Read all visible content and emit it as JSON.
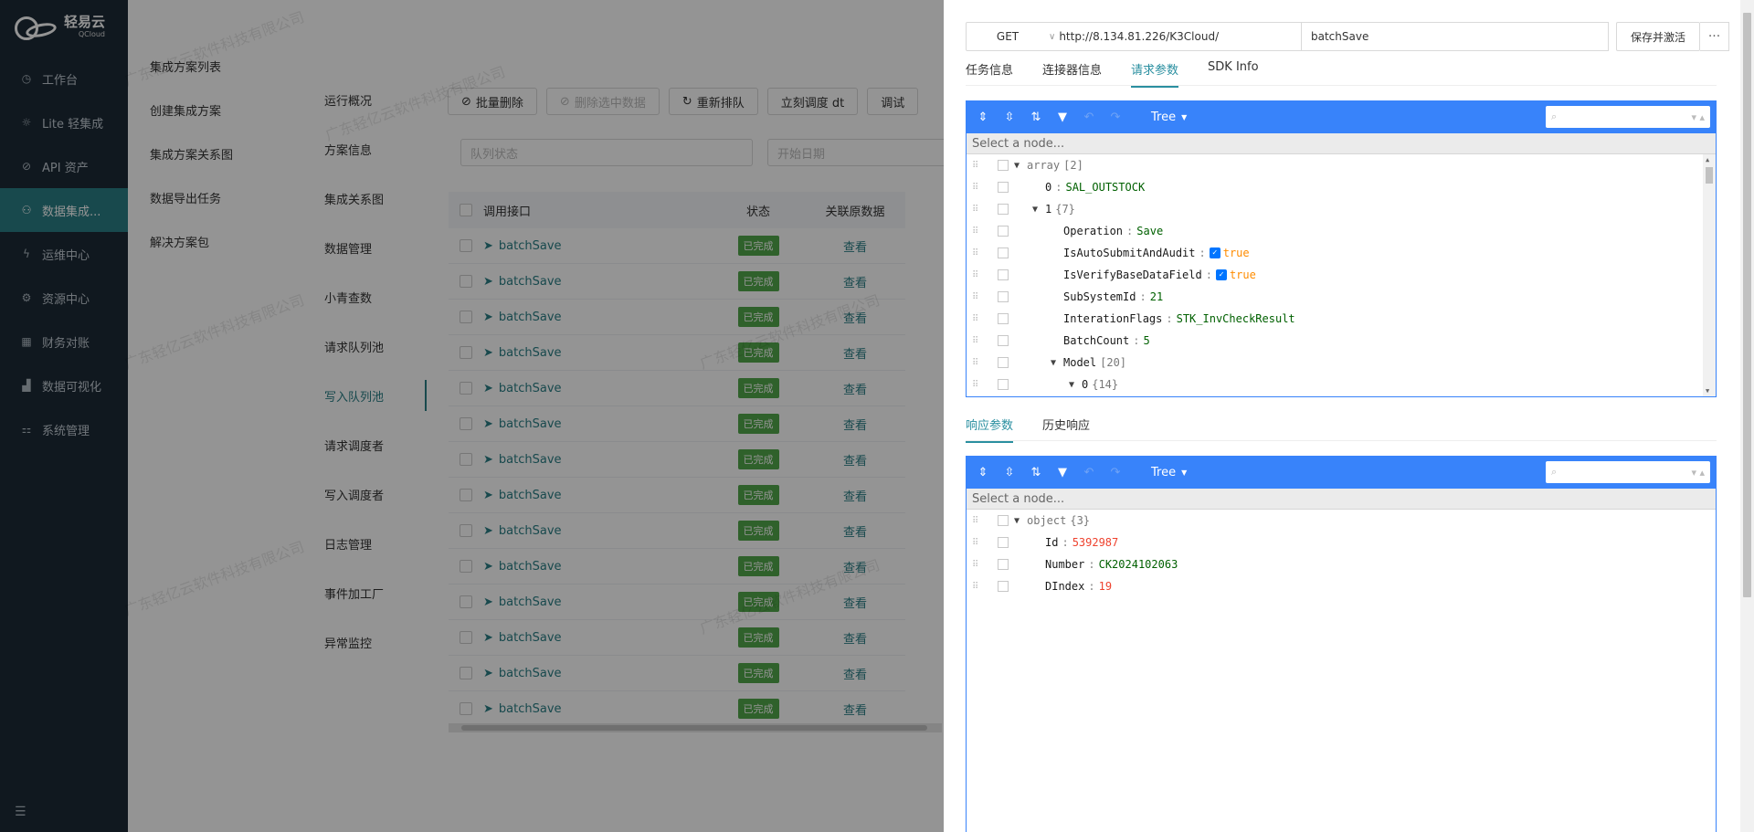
{
  "app": {
    "logo_text": "轻易云",
    "logo_sub": "QCloud"
  },
  "sidebar": {
    "items": [
      {
        "label": "工作台",
        "icon": "clock-icon"
      },
      {
        "label": "Lite 轻集成",
        "icon": "bulb-icon"
      },
      {
        "label": "API 资产",
        "icon": "compass-icon"
      },
      {
        "label": "数据集成...",
        "icon": "network-icon"
      },
      {
        "label": "运维中心",
        "icon": "bolt-icon"
      },
      {
        "label": "资源中心",
        "icon": "resource-icon"
      },
      {
        "label": "财务对账",
        "icon": "calculator-icon"
      },
      {
        "label": "数据可视化",
        "icon": "chart-icon"
      },
      {
        "label": "系统管理",
        "icon": "settings-icon"
      }
    ]
  },
  "submenu": {
    "items": [
      "集成方案列表",
      "创建集成方案",
      "集成方案关系图",
      "数据导出任务",
      "解决方案包"
    ]
  },
  "vertical_tabs": [
    "运行概况",
    "方案信息",
    "集成关系图",
    "数据管理",
    "小青查数",
    "请求队列池",
    "写入队列池",
    "请求调度者",
    "写入调度者",
    "日志管理",
    "事件加工厂",
    "异常监控"
  ],
  "toolbar": {
    "batch_delete": "批量删除",
    "delete_selected": "删除选中数据",
    "requeue": "重新排队",
    "dispatch_now": "立刻调度 dt",
    "debug": "调试"
  },
  "filters": {
    "queue_status_placeholder": "队列状态",
    "start_date_placeholder": "开始日期"
  },
  "table": {
    "headers": {
      "api": "调用接口",
      "status": "状态",
      "source": "关联原数据"
    },
    "rows": [
      {
        "api": "batchSave",
        "status": "已完成",
        "view": "查看"
      },
      {
        "api": "batchSave",
        "status": "已完成",
        "view": "查看"
      },
      {
        "api": "batchSave",
        "status": "已完成",
        "view": "查看"
      },
      {
        "api": "batchSave",
        "status": "已完成",
        "view": "查看"
      },
      {
        "api": "batchSave",
        "status": "已完成",
        "view": "查看"
      },
      {
        "api": "batchSave",
        "status": "已完成",
        "view": "查看"
      },
      {
        "api": "batchSave",
        "status": "已完成",
        "view": "查看"
      },
      {
        "api": "batchSave",
        "status": "已完成",
        "view": "查看"
      },
      {
        "api": "batchSave",
        "status": "已完成",
        "view": "查看"
      },
      {
        "api": "batchSave",
        "status": "已完成",
        "view": "查看"
      },
      {
        "api": "batchSave",
        "status": "已完成",
        "view": "查看"
      },
      {
        "api": "batchSave",
        "status": "已完成",
        "view": "查看"
      },
      {
        "api": "batchSave",
        "status": "已完成",
        "view": "查看"
      },
      {
        "api": "batchSave",
        "status": "已完成",
        "view": "查看"
      }
    ]
  },
  "watermark": "广东轻亿云软件科技有限公司",
  "drawer": {
    "method": "GET",
    "url": "http://8.134.81.226/K3Cloud/",
    "api_name": "batchSave",
    "save_activate": "保存并激活",
    "more": "···",
    "tabs": [
      "任务信息",
      "连接器信息",
      "请求参数",
      "SDK Info"
    ],
    "active_tab": "请求参数",
    "response_tabs": [
      "响应参数",
      "历史响应"
    ],
    "active_response_tab": "响应参数"
  },
  "json_editor": {
    "mode": "Tree",
    "nav_placeholder": "Select a node...",
    "request_tree": [
      {
        "key": "array",
        "info": "[2]",
        "indent": 0,
        "expand": "▼",
        "type": "info"
      },
      {
        "key": "0",
        "value": "SAL_OUTSTOCK",
        "indent": 1,
        "type": "str"
      },
      {
        "key": "1",
        "info": "{7}",
        "indent": 1,
        "expand": "▼",
        "type": "info"
      },
      {
        "key": "Operation",
        "value": "Save",
        "indent": 2,
        "type": "str"
      },
      {
        "key": "IsAutoSubmitAndAudit",
        "value": "true",
        "indent": 2,
        "type": "bool"
      },
      {
        "key": "IsVerifyBaseDataField",
        "value": "true",
        "indent": 2,
        "type": "bool"
      },
      {
        "key": "SubSystemId",
        "value": "21",
        "indent": 2,
        "type": "numg"
      },
      {
        "key": "InterationFlags",
        "value": "STK_InvCheckResult",
        "indent": 2,
        "type": "str"
      },
      {
        "key": "BatchCount",
        "value": "5",
        "indent": 2,
        "type": "numg"
      },
      {
        "key": "Model",
        "info": "[20]",
        "indent": 2,
        "expand": "▼",
        "type": "info"
      },
      {
        "key": "0",
        "info": "{14}",
        "indent": 3,
        "expand": "▼",
        "type": "info"
      }
    ],
    "response_tree": [
      {
        "key": "object",
        "info": "{3}",
        "indent": 0,
        "expand": "▼",
        "type": "info"
      },
      {
        "key": "Id ",
        "value": "5392987",
        "indent": 1,
        "type": "num"
      },
      {
        "key": "Number",
        "value": "CK2024102063",
        "indent": 1,
        "type": "str"
      },
      {
        "key": "DIndex",
        "value": "19",
        "indent": 1,
        "type": "num"
      }
    ]
  }
}
